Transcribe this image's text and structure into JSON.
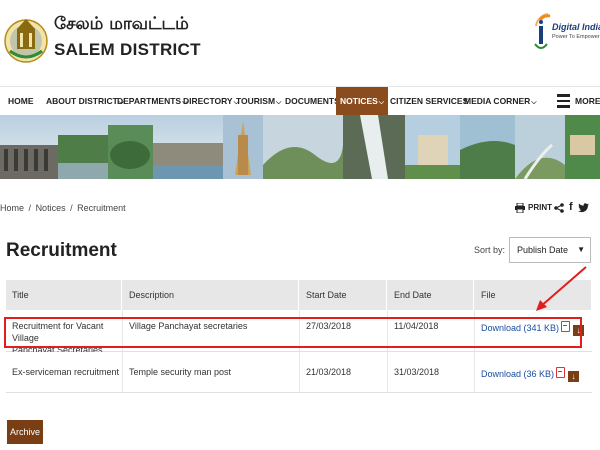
{
  "header": {
    "tamil_name": "சேலம் மாவட்டம்",
    "district_name": "SALEM DISTRICT",
    "digital_india_name": "Digital India",
    "digital_india_tagline": "Power To Empower"
  },
  "nav": {
    "items": [
      {
        "label": "HOME",
        "has_menu": false,
        "active": false
      },
      {
        "label": "ABOUT DISTRICT",
        "has_menu": true,
        "active": false
      },
      {
        "label": "DEPARTMENTS",
        "has_menu": true,
        "active": false
      },
      {
        "label": "DIRECTORY",
        "has_menu": true,
        "active": false
      },
      {
        "label": "TOURISM",
        "has_menu": true,
        "active": false
      },
      {
        "label": "DOCUMENTS",
        "has_menu": true,
        "active": false
      },
      {
        "label": "NOTICES",
        "has_menu": true,
        "active": true
      },
      {
        "label": "CITIZEN SERVICES",
        "has_menu": false,
        "active": false
      },
      {
        "label": "MEDIA CORNER",
        "has_menu": true,
        "active": false
      }
    ],
    "more_label": "MORE",
    "active_color": "#8a4b1d"
  },
  "breadcrumb": {
    "items": [
      "Home",
      "Notices",
      "Recruitment"
    ],
    "separator": "/"
  },
  "utility": {
    "print_label": "PRINT"
  },
  "page": {
    "title": "Recruitment",
    "sort_label": "Sort by:",
    "sort_selected": "Publish Date"
  },
  "table": {
    "columns": [
      "Title",
      "Description",
      "Start Date",
      "End Date",
      "File"
    ],
    "rows": [
      {
        "title_line1": "Recruitment for Vacant Village",
        "title_line2": "Panchayat Secretaries",
        "description": "Village Panchayat secretaries",
        "start_date": "27/03/2018",
        "end_date": "11/04/2018",
        "file_label": "Download (341 KB)",
        "highlighted": true
      },
      {
        "title_line1": "Ex-serviceman recruitment",
        "title_line2": "",
        "description": "Temple security man post",
        "start_date": "21/03/2018",
        "end_date": "31/03/2018",
        "file_label": "Download (36 KB)",
        "highlighted": false
      }
    ]
  },
  "footer": {
    "archive_label": "Archive"
  },
  "colors": {
    "brand": "#7a3e14",
    "highlight": "#e11d1d",
    "link": "#1a4c9c"
  }
}
